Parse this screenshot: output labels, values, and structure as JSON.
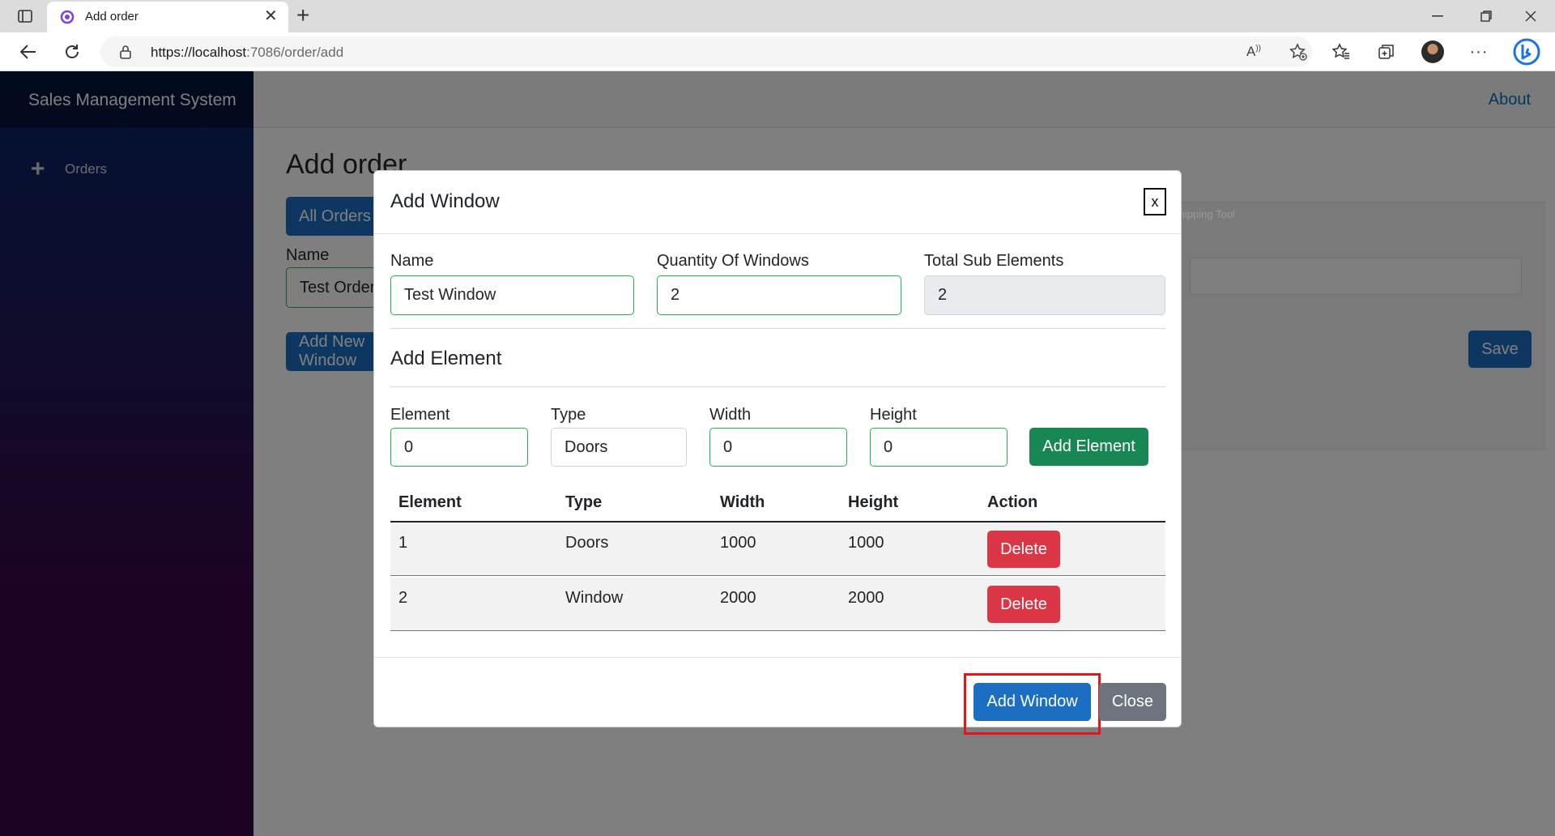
{
  "browser": {
    "tab_title": "Add order",
    "url_host": "https://localhost",
    "url_rest": ":7086/order/add"
  },
  "app": {
    "brand": "Sales Management System",
    "nav": [
      {
        "label": "Orders",
        "icon": "plus-icon"
      }
    ],
    "about": "About"
  },
  "page": {
    "title": "Add order",
    "all_orders_button": "All Orders",
    "name_label": "Name",
    "name_value": "Test Order",
    "add_new_button": "Add New Window",
    "save_button": "Save",
    "background_panel_title": "Snipping Tool"
  },
  "modal": {
    "title": "Add Window",
    "close_x": "x",
    "name_label": "Name",
    "name_value": "Test Window",
    "quantity_label": "Quantity Of Windows",
    "quantity_value": "2",
    "total_label": "Total Sub Elements",
    "total_value": "2",
    "section_title": "Add Element",
    "element_label": "Element",
    "element_value": "0",
    "type_label": "Type",
    "type_value": "Doors",
    "width_label": "Width",
    "width_value": "0",
    "height_label": "Height",
    "height_value": "0",
    "add_element_button": "Add Element",
    "table": {
      "headers": [
        "Element",
        "Type",
        "Width",
        "Height",
        "Action"
      ],
      "rows": [
        {
          "element": "1",
          "type": "Doors",
          "width": "1000",
          "height": "1000",
          "action": "Delete"
        },
        {
          "element": "2",
          "type": "Window",
          "width": "2000",
          "height": "2000",
          "action": "Delete"
        }
      ]
    },
    "add_window_button": "Add Window",
    "close_button": "Close"
  },
  "colors": {
    "primary": "#1b6ec2",
    "success": "#198754",
    "danger": "#dc3545",
    "secondary": "#6c757d",
    "highlight": "#e0161b"
  }
}
